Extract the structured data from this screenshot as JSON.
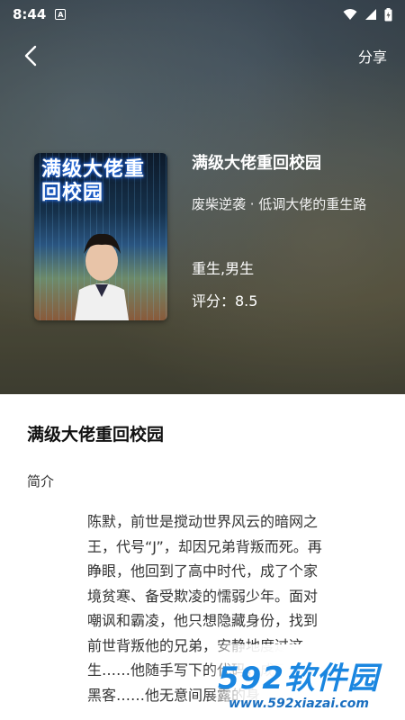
{
  "status_bar": {
    "time": "8:44",
    "indicator": "A",
    "icons": [
      "wifi-icon",
      "signal-icon",
      "battery-icon"
    ]
  },
  "nav": {
    "back_icon": "back-arrow-icon",
    "share_label": "分享"
  },
  "book": {
    "cover_title": "满级大佬重回校园",
    "title": "满级大佬重回校园",
    "subtitle": "废柴逆袭 · 低调大佬的重生路",
    "tags": "重生,男生",
    "rating": "评分：8.5"
  },
  "detail": {
    "title": "满级大佬重回校园",
    "intro_label": "简介",
    "intro_text": "陈默，前世是搅动世界风云的暗网之王，代号“J”，却因兄弟背叛而死。再睁眼，他回到了高中时代，成了个家境贫寒、备受欺凌的懦弱少年。面对嘲讽和霸凌，他只想隐藏身份，找到前世背叛他的兄弟，安静地度过这一生……他随手写下的代码，成了全球黑客……他无意间展露的身"
  },
  "watermark": {
    "logo_main": "592软件园",
    "url": "www.592xiazai.com"
  },
  "colors": {
    "watermark_blue": "#1a86e0",
    "watermark_red": "#e84a2b"
  }
}
